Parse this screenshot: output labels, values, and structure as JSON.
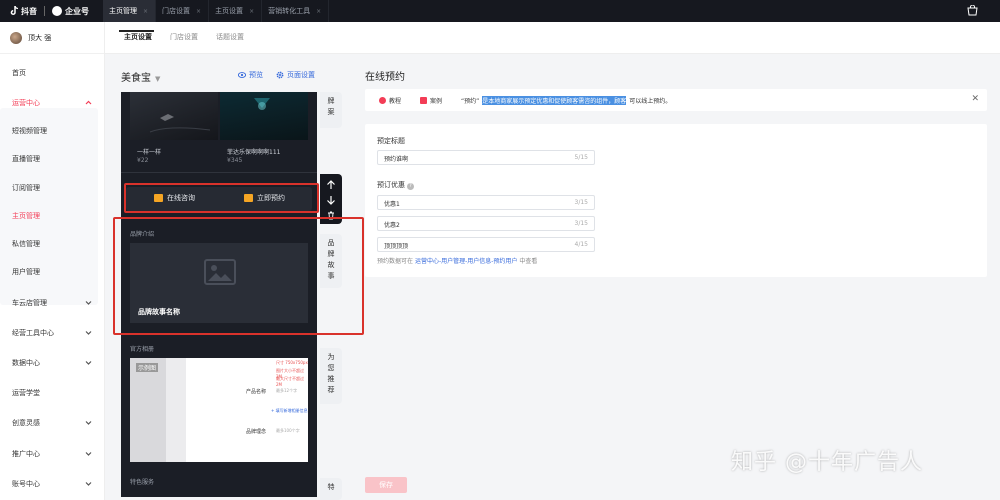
{
  "topbar": {
    "brand_douyin": "抖音",
    "brand_enterprise": "企业号",
    "tabs": [
      {
        "label": "主页管理",
        "close": "×"
      },
      {
        "label": "门店设置",
        "close": "×"
      },
      {
        "label": "主页设置",
        "close": "×"
      },
      {
        "label": "营销转化工具",
        "close": "×"
      }
    ],
    "shop_icon": "shopping-bag-icon"
  },
  "sidebar": {
    "user_name": "顶大 强",
    "items": [
      {
        "label": "首页"
      },
      {
        "label": "运营中心"
      },
      {
        "label": "短视频管理"
      },
      {
        "label": "直播管理"
      },
      {
        "label": "订阅管理"
      },
      {
        "label": "主页管理"
      },
      {
        "label": "私信管理"
      },
      {
        "label": "用户管理"
      },
      {
        "label": "车云店管理"
      },
      {
        "label": "经营工具中心"
      },
      {
        "label": "数据中心"
      },
      {
        "label": "运营学堂"
      },
      {
        "label": "创意灵感"
      },
      {
        "label": "推广中心"
      },
      {
        "label": "账号中心"
      }
    ],
    "active_color": "#f33d56"
  },
  "subnav": {
    "tabs": [
      {
        "label": "主页设置"
      },
      {
        "label": "门店设置"
      },
      {
        "label": "话题设置"
      }
    ]
  },
  "preview": {
    "shop_name": "美食宝",
    "preview_label": "预览",
    "settings_label": "页面设置",
    "products": [
      {
        "name": "一样一样",
        "price": "¥22"
      },
      {
        "name": "菲达乐保啊啊啊111",
        "price": "¥345"
      }
    ],
    "consult_label": "在线咨询",
    "book_label": "立即预约",
    "brand_section": "品牌介绍",
    "brand_story_name": "品牌故事名称",
    "album_section": "官方相册",
    "album_tag": "示例图",
    "album_field_name": "产品名称",
    "album_field_name_ph": "最多12个字",
    "album_add_link": "+ 填写新增相册信息",
    "album_field_desc": "品牌理念",
    "album_field_desc_ph": "最多100个字",
    "album_note1": "尺寸 750x750px",
    "album_note2": "图片大小不超过2M",
    "album_note3": "最大尺寸不超过2M",
    "feature_section": "特色服务",
    "side_tabs": [
      "牌",
      "案",
      "品",
      "牌",
      "故",
      "事",
      "为",
      "您",
      "推",
      "荐",
      "特"
    ]
  },
  "booking": {
    "title": "在线预约",
    "tutorial_label": "教程",
    "case_label": "案例",
    "notice_prefix": "“预约”",
    "notice_highlight": "是本地商家展示预定优惠和促使顾客需咨的组件，顾客",
    "notice_suffix": "可以线上预约。",
    "title_field_label": "预定标题",
    "title_value": "预约谁啊",
    "title_count": "5/15",
    "offer_label": "预订优惠",
    "offers": [
      {
        "value": "优惠1",
        "count": "3/15"
      },
      {
        "value": "优惠2",
        "count": "3/15"
      },
      {
        "value": "顶顶顶顶",
        "count": "4/15"
      }
    ],
    "hint_prefix": "预约数据可在",
    "hint_link": "运营中心-用户管理-用户信息-预约用户",
    "hint_suffix": "中查看",
    "save_label": "保存"
  },
  "watermark": "知乎 @十年广告人"
}
